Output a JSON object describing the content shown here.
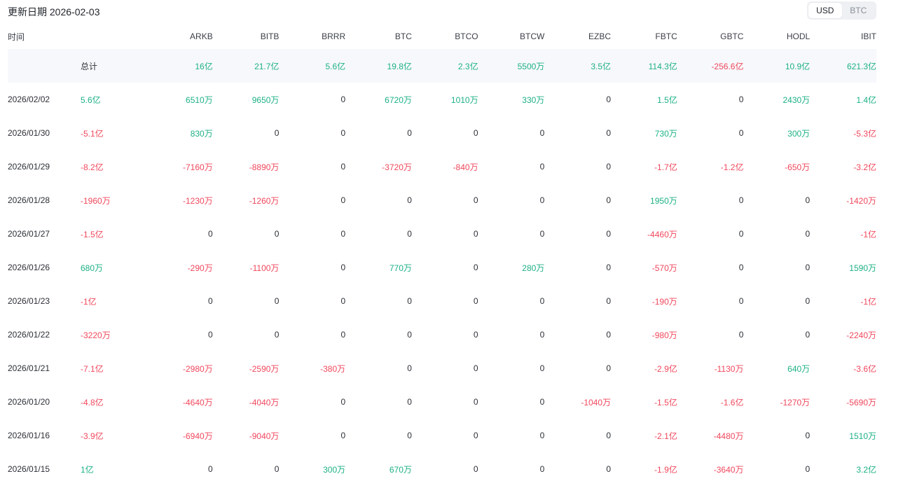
{
  "header": {
    "update_label": "更新日期 2026-02-03",
    "currency_options": [
      "USD",
      "BTC"
    ],
    "currency_selected": "USD"
  },
  "colors": {
    "positive": "#1db184",
    "negative": "#f0475c",
    "summary_bg": "#f7f8fb"
  },
  "table": {
    "columns": [
      "时间",
      "",
      "ARKB",
      "BITB",
      "BRRR",
      "BTC",
      "BTCO",
      "BTCW",
      "EZBC",
      "FBTC",
      "GBTC",
      "HODL",
      "IBIT"
    ],
    "summary": {
      "date": "",
      "total": "总计",
      "values": [
        "16亿",
        "21.7亿",
        "5.6亿",
        "19.8亿",
        "2.3亿",
        "5500万",
        "3.5亿",
        "114.3亿",
        "-256.6亿",
        "10.9亿",
        "621.3亿"
      ]
    },
    "rows": [
      {
        "date": "2026/02/02",
        "total": "5.6亿",
        "values": [
          "6510万",
          "9650万",
          "0",
          "6720万",
          "1010万",
          "330万",
          "0",
          "1.5亿",
          "0",
          "2430万",
          "1.4亿"
        ]
      },
      {
        "date": "2026/01/30",
        "total": "-5.1亿",
        "values": [
          "830万",
          "0",
          "0",
          "0",
          "0",
          "0",
          "0",
          "730万",
          "0",
          "300万",
          "-5.3亿"
        ]
      },
      {
        "date": "2026/01/29",
        "total": "-8.2亿",
        "values": [
          "-7160万",
          "-8890万",
          "0",
          "-3720万",
          "-840万",
          "0",
          "0",
          "-1.7亿",
          "-1.2亿",
          "-650万",
          "-3.2亿"
        ]
      },
      {
        "date": "2026/01/28",
        "total": "-1960万",
        "values": [
          "-1230万",
          "-1260万",
          "0",
          "0",
          "0",
          "0",
          "0",
          "1950万",
          "0",
          "0",
          "-1420万"
        ]
      },
      {
        "date": "2026/01/27",
        "total": "-1.5亿",
        "values": [
          "0",
          "0",
          "0",
          "0",
          "0",
          "0",
          "0",
          "-4460万",
          "0",
          "0",
          "-1亿"
        ]
      },
      {
        "date": "2026/01/26",
        "total": "680万",
        "values": [
          "-290万",
          "-1100万",
          "0",
          "770万",
          "0",
          "280万",
          "0",
          "-570万",
          "0",
          "0",
          "1590万"
        ]
      },
      {
        "date": "2026/01/23",
        "total": "-1亿",
        "values": [
          "0",
          "0",
          "0",
          "0",
          "0",
          "0",
          "0",
          "-190万",
          "0",
          "0",
          "-1亿"
        ]
      },
      {
        "date": "2026/01/22",
        "total": "-3220万",
        "values": [
          "0",
          "0",
          "0",
          "0",
          "0",
          "0",
          "0",
          "-980万",
          "0",
          "0",
          "-2240万"
        ]
      },
      {
        "date": "2026/01/21",
        "total": "-7.1亿",
        "values": [
          "-2980万",
          "-2590万",
          "-380万",
          "0",
          "0",
          "0",
          "0",
          "-2.9亿",
          "-1130万",
          "640万",
          "-3.6亿"
        ]
      },
      {
        "date": "2026/01/20",
        "total": "-4.8亿",
        "values": [
          "-4640万",
          "-4040万",
          "0",
          "0",
          "0",
          "0",
          "-1040万",
          "-1.5亿",
          "-1.6亿",
          "-1270万",
          "-5690万"
        ]
      },
      {
        "date": "2026/01/16",
        "total": "-3.9亿",
        "values": [
          "-6940万",
          "-9040万",
          "0",
          "0",
          "0",
          "0",
          "0",
          "-2.1亿",
          "-4480万",
          "0",
          "1510万"
        ]
      },
      {
        "date": "2026/01/15",
        "total": "1亿",
        "values": [
          "0",
          "0",
          "300万",
          "670万",
          "0",
          "0",
          "0",
          "-1.9亿",
          "-3640万",
          "0",
          "3.2亿"
        ]
      }
    ]
  }
}
